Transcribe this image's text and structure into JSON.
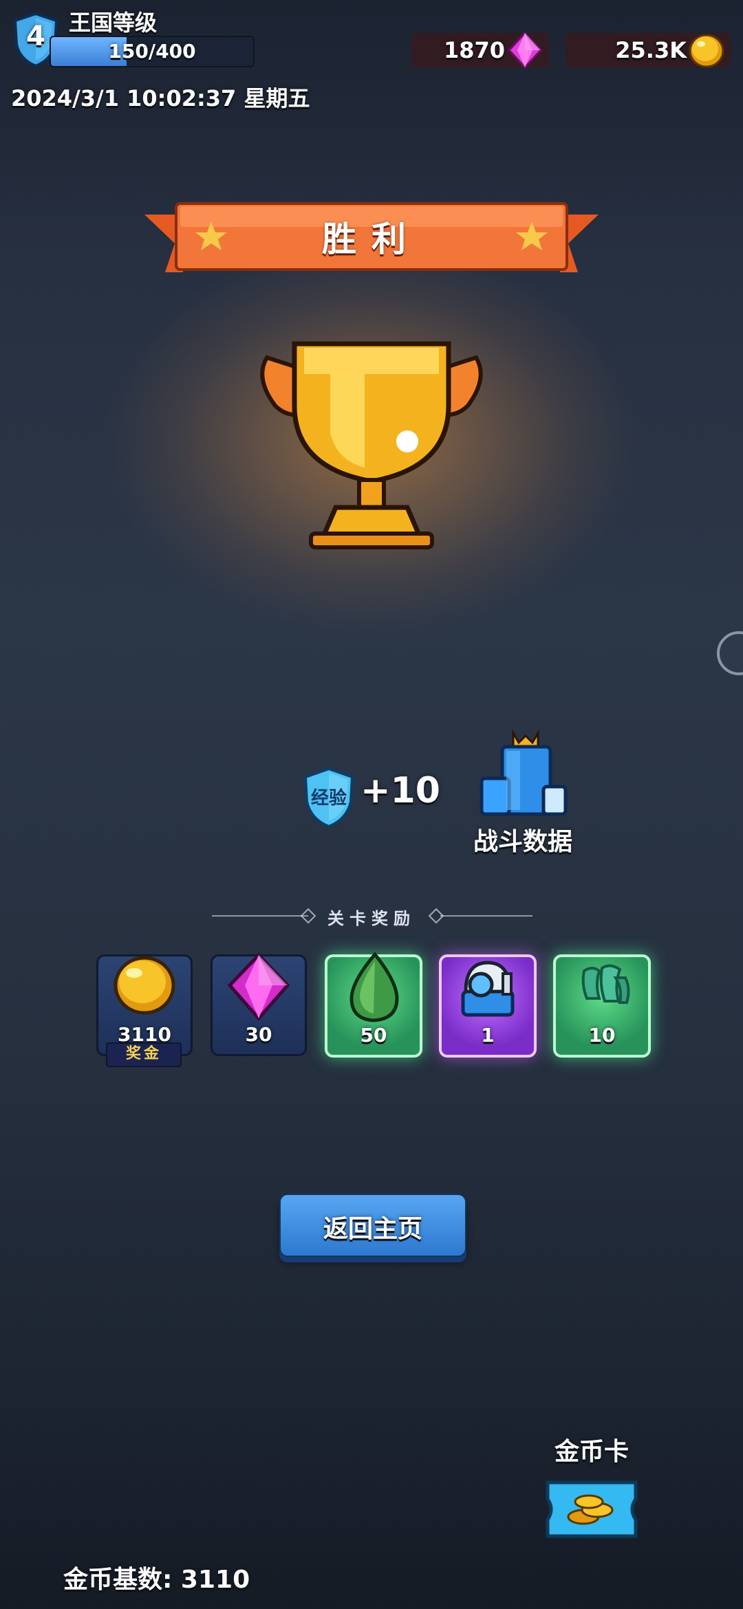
{
  "header": {
    "level": "4",
    "kingdom_label": "王国等级",
    "exp_text": "150/400",
    "exp_progress": 0.375,
    "datetime": "2024/3/1 10:02:37 星期五",
    "gems": "1870",
    "gold": "25.3K"
  },
  "result": {
    "title": "胜利",
    "exp_badge": "经验",
    "exp_gain": "+10",
    "stats_label": "战斗数据"
  },
  "rewards": {
    "title": "关卡奖励",
    "items": [
      {
        "icon": "gold-coin-icon",
        "qty": "3110",
        "tag": "奖金"
      },
      {
        "icon": "pink-gem-icon",
        "qty": "30"
      },
      {
        "icon": "green-drop-icon",
        "qty": "50"
      },
      {
        "icon": "turret-icon",
        "qty": "1"
      },
      {
        "icon": "green-shards-icon",
        "qty": "10"
      }
    ]
  },
  "actions": {
    "home_label": "返回主页",
    "gold_card_label": "金币卡",
    "gold_base": "金币基数: 3110"
  },
  "colors": {
    "banner": "#f2763a",
    "button": "#3b88dc",
    "gold": "#f7c52a",
    "gem": "#e23dd8"
  }
}
